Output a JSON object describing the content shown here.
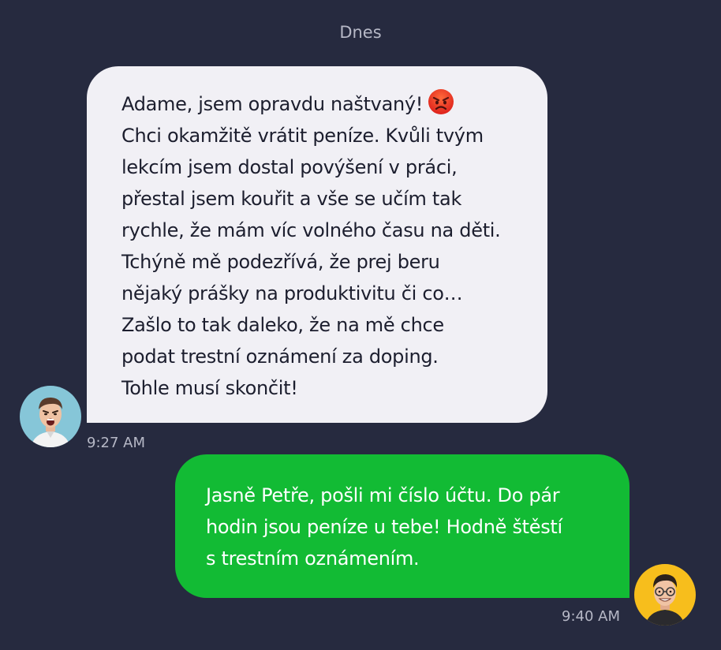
{
  "conversation": {
    "date_label": "Dnes",
    "messages": [
      {
        "direction": "incoming",
        "sender_emoji": "angry-face-emoji",
        "first_line": "Adame, jsem opravdu naštvaný!",
        "body": "Chci okamžitě vrátit peníze. Kvůli tvým\nlekcím jsem dostal povýšení v práci,\npřestal jsem kouřit a vše se učím tak\nrychle, že mám víc volného času na děti.\nTchýně mě podezřívá, že prej beru\nnějaký prášky na produktivitu či co…\nZašlo to tak daleko, že na mě chce\npodat trestní oznámení za doping.\nTohle musí skončit!",
        "time": "9:27 AM"
      },
      {
        "direction": "outgoing",
        "body": "Jasně Petře, pošli mi číslo účtu. Do pár\nhodin jsou peníze u tebe! Hodně štěstí\ns trestním oznámením.",
        "time": "9:40 AM"
      }
    ]
  },
  "colors": {
    "background": "#262a3f",
    "incoming_bubble": "#f1f0f5",
    "outgoing_bubble": "#12bb34",
    "timestamp": "#b6b8c6"
  }
}
